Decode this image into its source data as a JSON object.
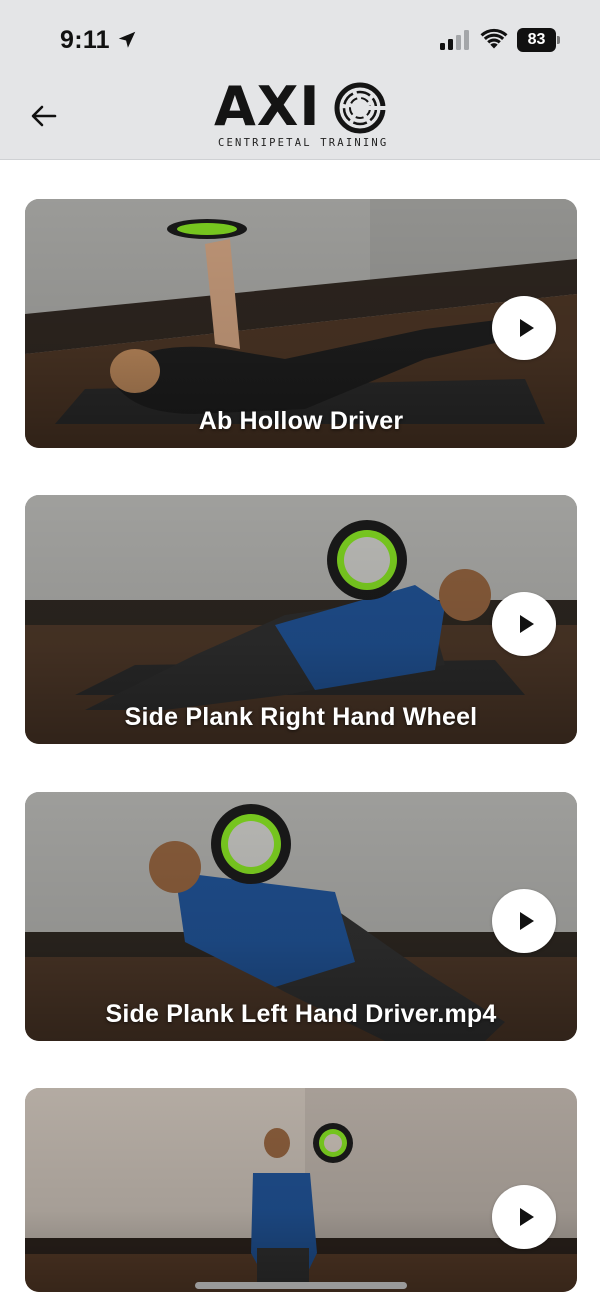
{
  "status_bar": {
    "time": "9:11",
    "battery": "83"
  },
  "header": {
    "logo_word": "AXI",
    "logo_tagline": "CENTRIPETAL TRAINING"
  },
  "icons": {
    "back": "arrow-left-icon",
    "play": "play-icon",
    "location": "location-arrow-icon",
    "signal": "cellular-signal-icon",
    "wifi": "wifi-icon",
    "battery": "battery-icon"
  },
  "colors": {
    "header_bg": "#e4e5e7",
    "wheel_accent": "#7ed321"
  },
  "videos": [
    {
      "title": "Ab Hollow Driver"
    },
    {
      "title": "Side Plank Right Hand Wheel"
    },
    {
      "title": "Side Plank Left Hand Driver.mp4"
    },
    {
      "title": ""
    }
  ]
}
